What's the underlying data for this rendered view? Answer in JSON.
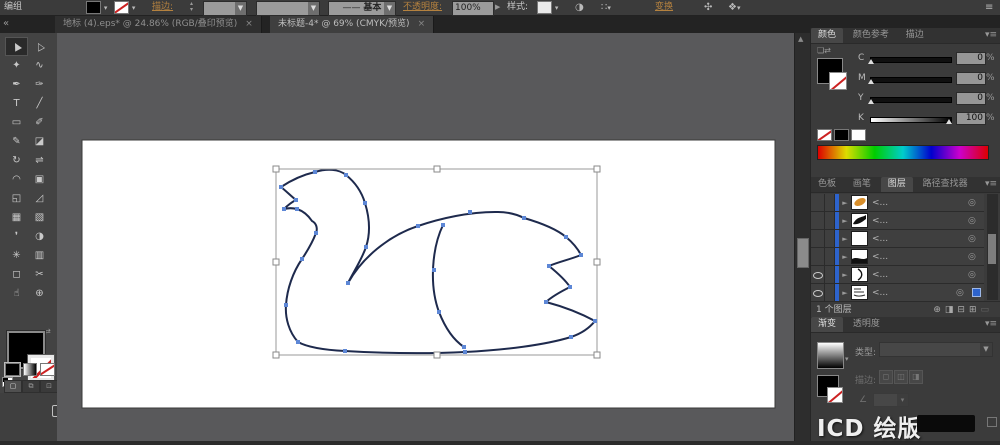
{
  "control_bar": {
    "selection_label": "编组",
    "stroke_label": "描边:",
    "brush_value": "基本",
    "opacity_label": "不透明度:",
    "opacity_value": "100%",
    "style_label": "样式:",
    "transform_label": "变换",
    "accent_color": "#b5823f"
  },
  "document_tabs": [
    {
      "title": "地标 (4).eps* @ 24.86% (RGB/叠印预览)",
      "close_label": "×"
    },
    {
      "title": "未标题-4* @ 69% (CMYK/预览)",
      "close_label": "×"
    }
  ],
  "toolbar": {
    "tools": [
      {
        "name": "selection-tool",
        "glyph": "▲"
      },
      {
        "name": "direct-selection-tool",
        "glyph": "△"
      },
      {
        "name": "magic-wand-tool",
        "glyph": "✦"
      },
      {
        "name": "lasso-tool",
        "glyph": "∿"
      },
      {
        "name": "pen-tool",
        "glyph": "✒"
      },
      {
        "name": "curvature-pen-tool",
        "glyph": "✑"
      },
      {
        "name": "type-tool",
        "glyph": "T"
      },
      {
        "name": "line-segment-tool",
        "glyph": "╱"
      },
      {
        "name": "rectangle-tool",
        "glyph": "▭"
      },
      {
        "name": "paintbrush-tool",
        "glyph": "✐"
      },
      {
        "name": "pencil-tool",
        "glyph": "✎"
      },
      {
        "name": "eraser-tool",
        "glyph": "◪"
      },
      {
        "name": "rotate-tool",
        "glyph": "↻"
      },
      {
        "name": "reflect-tool",
        "glyph": "⇌"
      },
      {
        "name": "width-tool",
        "glyph": "◠"
      },
      {
        "name": "free-transform-tool",
        "glyph": "▣"
      },
      {
        "name": "shape-builder-tool",
        "glyph": "◱"
      },
      {
        "name": "perspective-grid-tool",
        "glyph": "◿"
      },
      {
        "name": "mesh-tool",
        "glyph": "▦"
      },
      {
        "name": "gradient-tool",
        "glyph": "▧"
      },
      {
        "name": "eyedropper-tool",
        "glyph": "❜"
      },
      {
        "name": "blend-tool",
        "glyph": "◑"
      },
      {
        "name": "symbol-sprayer-tool",
        "glyph": "✳"
      },
      {
        "name": "graph-tool",
        "glyph": "▥"
      },
      {
        "name": "artboard-tool",
        "glyph": "◻"
      },
      {
        "name": "slice-tool",
        "glyph": "✂"
      },
      {
        "name": "hand-tool",
        "glyph": "☝"
      },
      {
        "name": "zoom-tool",
        "glyph": "⊕"
      }
    ]
  },
  "panels": {
    "color": {
      "tabs": [
        "颜色",
        "颜色参考",
        "描边"
      ],
      "sliders": [
        {
          "label": "C",
          "value": "0",
          "unit": "%"
        },
        {
          "label": "M",
          "value": "0",
          "unit": "%"
        },
        {
          "label": "Y",
          "value": "0",
          "unit": "%"
        },
        {
          "label": "K",
          "value": "100",
          "unit": "%"
        }
      ]
    },
    "layers": {
      "tabs": [
        "色板",
        "画笔",
        "图层",
        "路径查找器"
      ],
      "rows": [
        {
          "label": "<..."
        },
        {
          "label": "<..."
        },
        {
          "label": "<..."
        },
        {
          "label": "<..."
        },
        {
          "label": "<..."
        },
        {
          "label": "<..."
        }
      ],
      "footer": "1 个图层"
    },
    "gradient": {
      "tabs": [
        "渐变",
        "透明度"
      ],
      "type_label": "类型:",
      "stroke_label": "描边:"
    }
  },
  "watermark": {
    "prefix": "ICD",
    "text": "绘版"
  }
}
